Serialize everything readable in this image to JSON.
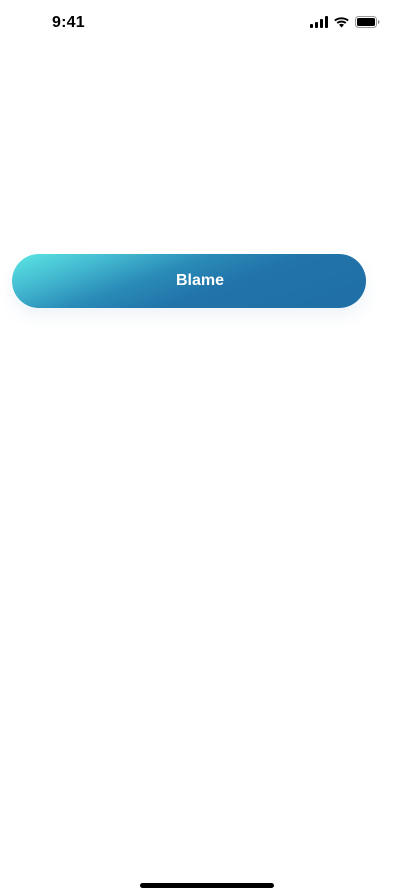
{
  "status_bar": {
    "time": "9:41",
    "signal_icon": "cellular-signal-icon",
    "wifi_icon": "wifi-icon",
    "battery_icon": "battery-icon"
  },
  "main": {
    "blame_button_label": "Blame",
    "button_gradient": [
      "#5ce7e4",
      "#2a8bb8",
      "#1f6fa7"
    ]
  },
  "colors": {
    "background": "#ffffff",
    "text_primary": "#000000",
    "button_text": "#ffffff"
  }
}
